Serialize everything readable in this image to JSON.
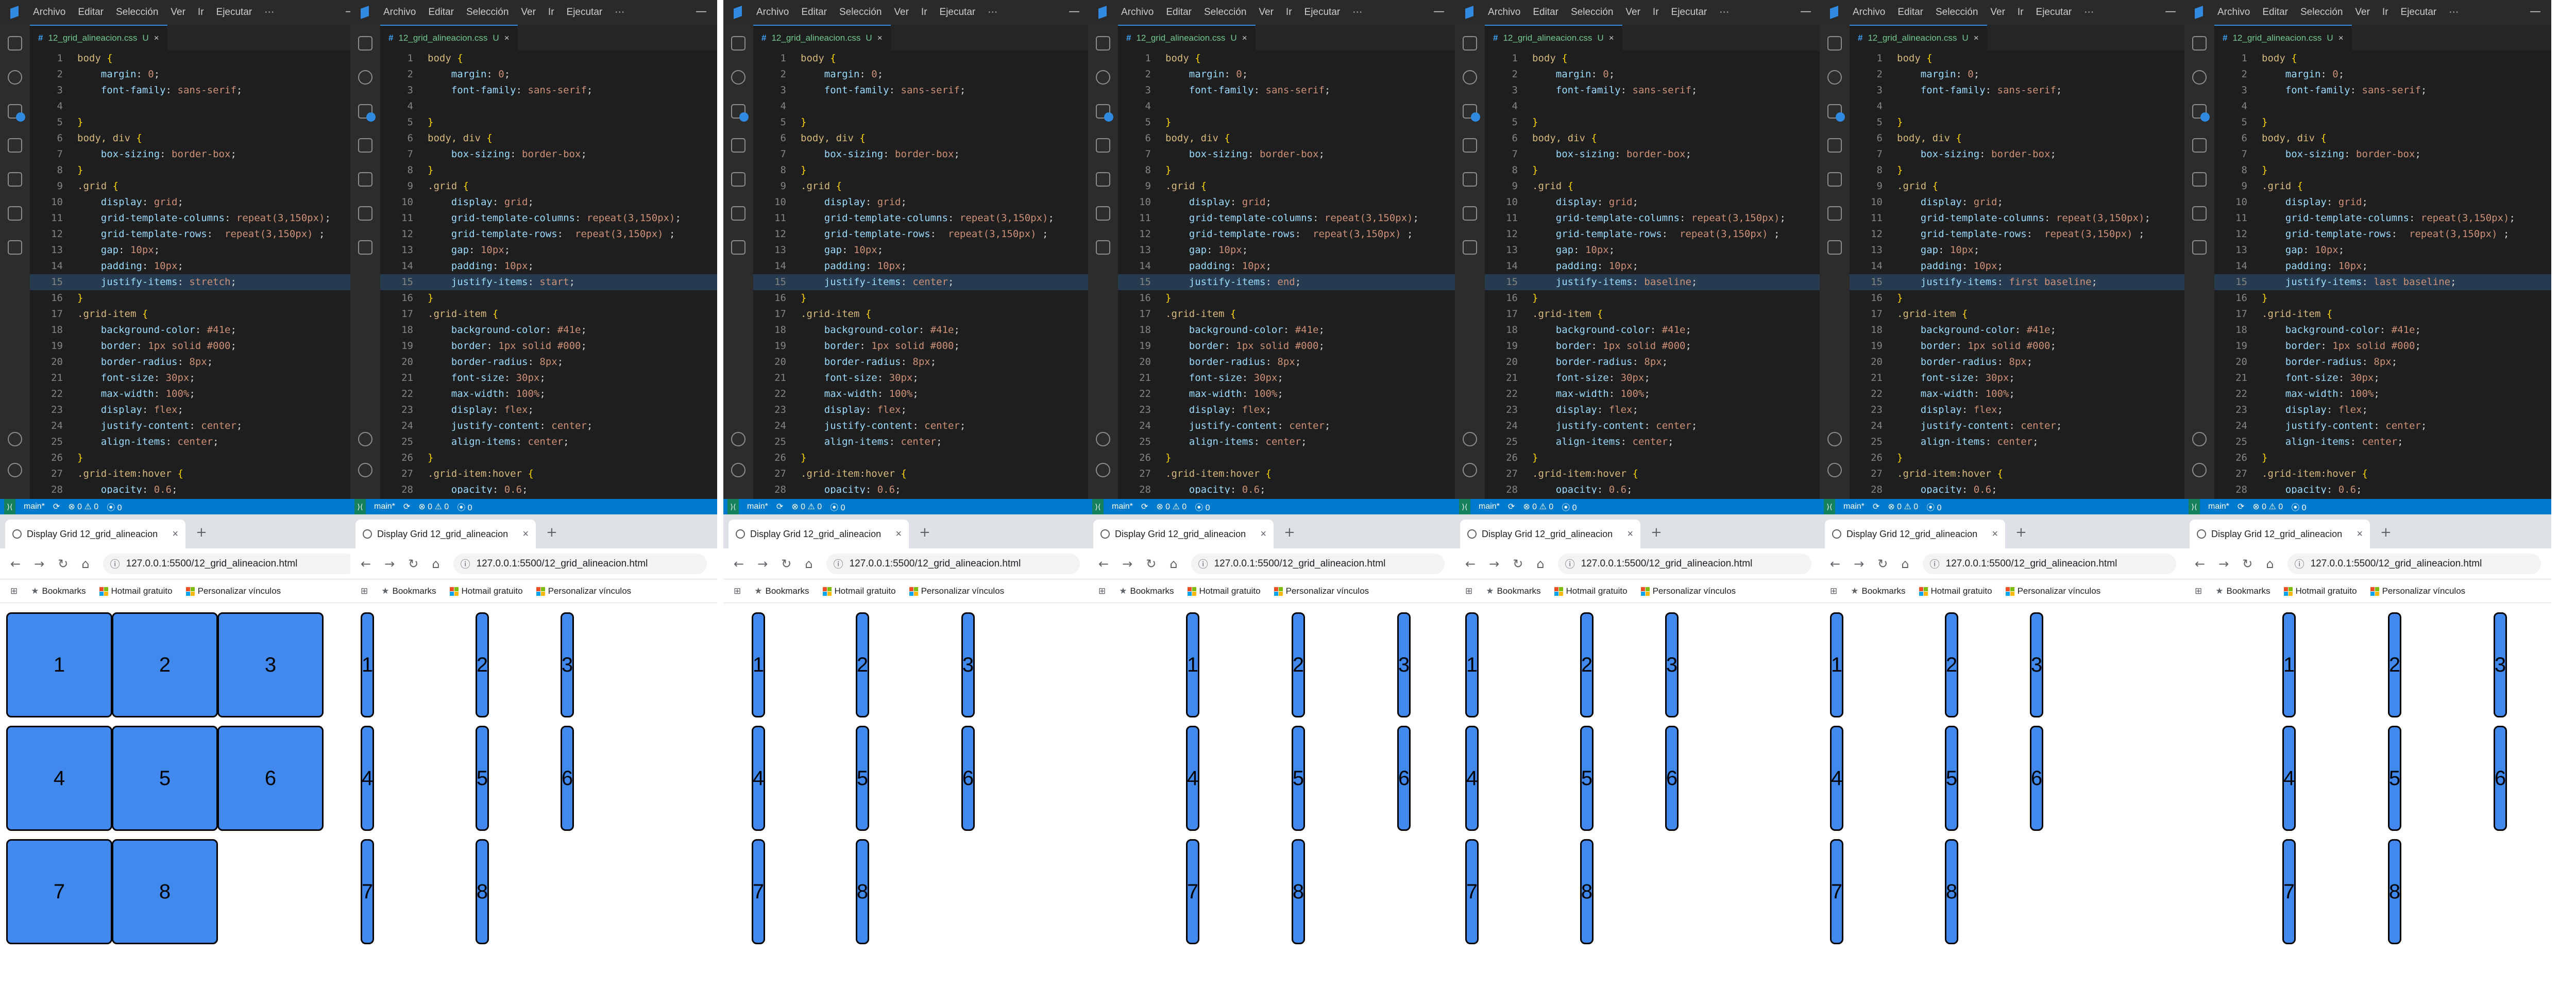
{
  "window": {
    "menu": [
      "Archivo",
      "Editar",
      "Selección",
      "Ver",
      "Ir",
      "Ejecutar",
      "···"
    ]
  },
  "editor_tab": {
    "filename": "12_grid_alineacion.css",
    "status": "U"
  },
  "code_lines": [
    {
      "n": "1",
      "parts": [
        {
          "t": "body",
          "c": "sel"
        },
        {
          "t": " {",
          "c": "brace"
        }
      ]
    },
    {
      "n": "2",
      "parts": [
        {
          "t": "    "
        },
        {
          "t": "margin",
          "c": "prop"
        },
        {
          "t": ": "
        },
        {
          "t": "0",
          "c": "val"
        },
        {
          "t": ";"
        }
      ]
    },
    {
      "n": "3",
      "parts": [
        {
          "t": "    "
        },
        {
          "t": "font-family",
          "c": "prop"
        },
        {
          "t": ": "
        },
        {
          "t": "sans-serif",
          "c": "val"
        },
        {
          "t": ";"
        }
      ]
    },
    {
      "n": "4",
      "parts": []
    },
    {
      "n": "5",
      "parts": [
        {
          "t": "}",
          "c": "brace"
        }
      ]
    },
    {
      "n": "6",
      "parts": [
        {
          "t": "body, div",
          "c": "sel"
        },
        {
          "t": " {",
          "c": "brace"
        }
      ]
    },
    {
      "n": "7",
      "parts": [
        {
          "t": "    "
        },
        {
          "t": "box-sizing",
          "c": "prop"
        },
        {
          "t": ": "
        },
        {
          "t": "border-box",
          "c": "val"
        },
        {
          "t": ";"
        }
      ]
    },
    {
      "n": "8",
      "parts": [
        {
          "t": "}",
          "c": "brace"
        }
      ]
    },
    {
      "n": "9",
      "parts": [
        {
          "t": ".grid",
          "c": "sel"
        },
        {
          "t": " {",
          "c": "brace"
        }
      ]
    },
    {
      "n": "10",
      "parts": [
        {
          "t": "    "
        },
        {
          "t": "display",
          "c": "prop"
        },
        {
          "t": ": "
        },
        {
          "t": "grid",
          "c": "val"
        },
        {
          "t": ";"
        }
      ]
    },
    {
      "n": "11",
      "parts": [
        {
          "t": "    "
        },
        {
          "t": "grid-template-columns",
          "c": "prop"
        },
        {
          "t": ": "
        },
        {
          "t": "repeat(3,150px)",
          "c": "val"
        },
        {
          "t": ";"
        }
      ]
    },
    {
      "n": "12",
      "parts": [
        {
          "t": "    "
        },
        {
          "t": "grid-template-rows",
          "c": "prop"
        },
        {
          "t": ":  "
        },
        {
          "t": "repeat(3,150px)",
          "c": "val"
        },
        {
          "t": " ;"
        }
      ]
    },
    {
      "n": "13",
      "parts": [
        {
          "t": "    "
        },
        {
          "t": "gap",
          "c": "prop"
        },
        {
          "t": ": "
        },
        {
          "t": "10px",
          "c": "val"
        },
        {
          "t": ";"
        }
      ]
    },
    {
      "n": "14",
      "parts": [
        {
          "t": "    "
        },
        {
          "t": "padding",
          "c": "prop"
        },
        {
          "t": ": "
        },
        {
          "t": "10px",
          "c": "val"
        },
        {
          "t": ";"
        }
      ]
    },
    {
      "n": "15",
      "parts": [
        {
          "t": "    "
        },
        {
          "t": "justify-items",
          "c": "prop"
        },
        {
          "t": ": "
        },
        {
          "t": "",
          "c": "val",
          "ji": true
        },
        {
          "t": ";"
        }
      ],
      "hl": true
    },
    {
      "n": "16",
      "parts": [
        {
          "t": "}",
          "c": "brace"
        }
      ]
    },
    {
      "n": "17",
      "parts": [
        {
          "t": ".grid-item",
          "c": "sel"
        },
        {
          "t": " {",
          "c": "brace"
        }
      ]
    },
    {
      "n": "18",
      "parts": [
        {
          "t": "    "
        },
        {
          "t": "background-color",
          "c": "prop"
        },
        {
          "t": ": "
        },
        {
          "t": "#41e",
          "c": "val"
        },
        {
          "t": ";"
        }
      ]
    },
    {
      "n": "19",
      "parts": [
        {
          "t": "    "
        },
        {
          "t": "border",
          "c": "prop"
        },
        {
          "t": ": "
        },
        {
          "t": "1px solid #000",
          "c": "val"
        },
        {
          "t": ";"
        }
      ]
    },
    {
      "n": "20",
      "parts": [
        {
          "t": "    "
        },
        {
          "t": "border-radius",
          "c": "prop"
        },
        {
          "t": ": "
        },
        {
          "t": "8px",
          "c": "val"
        },
        {
          "t": ";"
        }
      ]
    },
    {
      "n": "21",
      "parts": [
        {
          "t": "    "
        },
        {
          "t": "font-size",
          "c": "prop"
        },
        {
          "t": ": "
        },
        {
          "t": "30px",
          "c": "val"
        },
        {
          "t": ";"
        }
      ]
    },
    {
      "n": "22",
      "parts": [
        {
          "t": "    "
        },
        {
          "t": "max-width",
          "c": "prop"
        },
        {
          "t": ": "
        },
        {
          "t": "100%",
          "c": "val"
        },
        {
          "t": ";"
        }
      ]
    },
    {
      "n": "23",
      "parts": [
        {
          "t": "    "
        },
        {
          "t": "display",
          "c": "prop"
        },
        {
          "t": ": "
        },
        {
          "t": "flex",
          "c": "val"
        },
        {
          "t": ";"
        }
      ]
    },
    {
      "n": "24",
      "parts": [
        {
          "t": "    "
        },
        {
          "t": "justify-content",
          "c": "prop"
        },
        {
          "t": ": "
        },
        {
          "t": "center",
          "c": "val"
        },
        {
          "t": ";"
        }
      ]
    },
    {
      "n": "25",
      "parts": [
        {
          "t": "    "
        },
        {
          "t": "align-items",
          "c": "prop"
        },
        {
          "t": ": "
        },
        {
          "t": "center",
          "c": "val"
        },
        {
          "t": ";"
        }
      ]
    },
    {
      "n": "26",
      "parts": [
        {
          "t": "}",
          "c": "brace"
        }
      ]
    },
    {
      "n": "27",
      "parts": [
        {
          "t": ".grid-item:hover",
          "c": "sel"
        },
        {
          "t": " {",
          "c": "brace"
        }
      ]
    },
    {
      "n": "28",
      "parts": [
        {
          "t": "    "
        },
        {
          "t": "opacity",
          "c": "prop"
        },
        {
          "t": ": "
        },
        {
          "t": "0.6",
          "c": "val"
        },
        {
          "t": ";"
        }
      ]
    }
  ],
  "statusbar": {
    "branch": "main*",
    "sync": "⟳",
    "errors": "⊗ 0 ⚠ 0",
    "ports": "⦿ 0"
  },
  "browser": {
    "tab_title": "Display Grid 12_grid_alineacion",
    "url": "127.0.0.1:5500/12_grid_alineacion.html",
    "bookmarks": [
      "Bookmarks",
      "Hotmail gratuito",
      "Personalizar vínculos"
    ]
  },
  "grid_items": [
    "1",
    "2",
    "3",
    "4",
    "5",
    "6",
    "7",
    "8"
  ],
  "panels": [
    {
      "justify_items": "stretch"
    },
    {
      "justify_items": "start"
    },
    {
      "justify_items": "center"
    },
    {
      "justify_items": "end"
    },
    {
      "justify_items": "baseline"
    },
    {
      "justify_items": "first baseline"
    },
    {
      "justify_items": "last baseline"
    }
  ],
  "colors": {
    "item_fill": "#4189ed",
    "item_border": "#000000",
    "statusbar": "#007acc",
    "editor_bg": "#1e1e1e"
  }
}
